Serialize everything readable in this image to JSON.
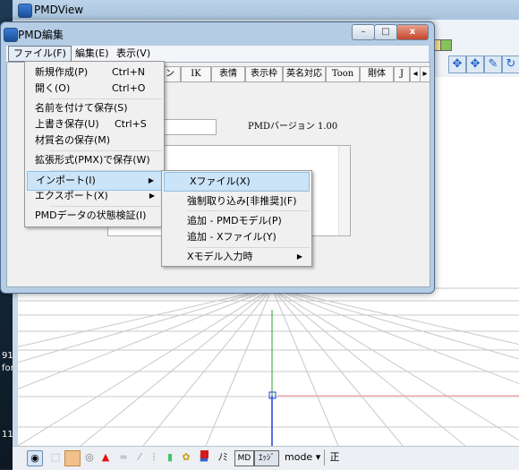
{
  "desktop": {
    "items": [
      "91",
      "for",
      "11"
    ]
  },
  "main_window": {
    "title": "PMDView",
    "bottom_toolbar": {
      "mode_label": "mode",
      "mode_arrow": "▾",
      "sei_label": "正",
      "nomi_label": "ﾉﾐ",
      "edge_label": "ｴｯｼﾞ",
      "md_label": "MD"
    }
  },
  "edit_window": {
    "title": "PMD編集",
    "controls": {
      "minimize": "–",
      "maximize": "□",
      "close": "x"
    },
    "menubar": [
      "ファイル(F)",
      "編集(E)",
      "表示(V)"
    ],
    "columns": [
      "ン",
      "IK",
      "表情",
      "表示枠",
      "英名対応",
      "Toon",
      "剛体",
      "J"
    ],
    "version_label": "PMDバージョン 1.00"
  },
  "file_menu": {
    "items": [
      {
        "label": "新規作成(P)",
        "shortcut": "Ctrl+N"
      },
      {
        "label": "開く(O)",
        "shortcut": "Ctrl+O"
      },
      {
        "label": "名前を付けて保存(S)",
        "shortcut": ""
      },
      {
        "label": "上書き保存(U)",
        "shortcut": "Ctrl+S"
      },
      {
        "label": "材質名の保存(M)",
        "shortcut": ""
      },
      {
        "label": "拡張形式(PMX)で保存(W)",
        "shortcut": ""
      },
      {
        "label": "インポート(I)",
        "shortcut": ""
      },
      {
        "label": "エクスポート(X)",
        "shortcut": ""
      },
      {
        "label": "PMDデータの状態検証(I)",
        "shortcut": ""
      }
    ]
  },
  "import_submenu": {
    "items": [
      {
        "label": "Xファイル(X)"
      },
      {
        "label": "強制取り込み[非推奨](F)"
      },
      {
        "label": "追加 - PMDモデル(P)"
      },
      {
        "label": "追加 - Xファイル(Y)"
      },
      {
        "label": "Xモデル入力時"
      }
    ]
  },
  "colors": {
    "axis_green": "#2ca02c",
    "axis_blue": "#1f3fd8",
    "axis_red": "#ff9a9a",
    "menu_highlight": "#cce4f7"
  }
}
